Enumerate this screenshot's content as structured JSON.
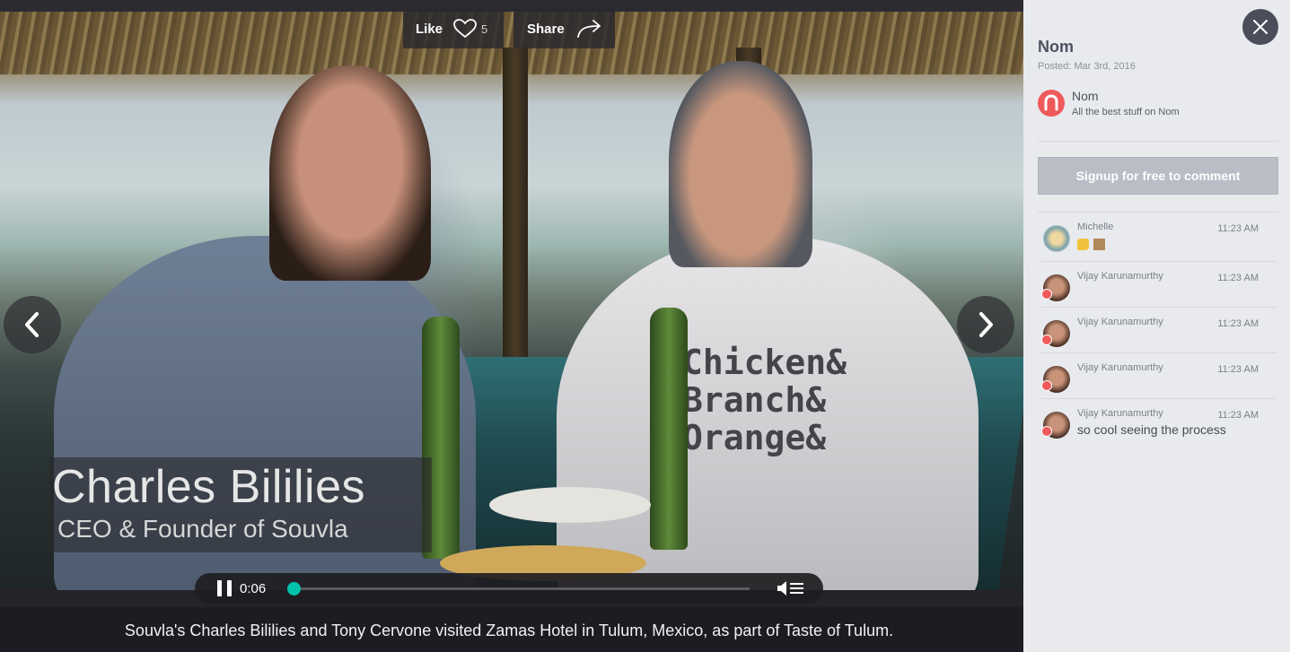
{
  "video": {
    "like_label": "Like",
    "like_count": "5",
    "share_label": "Share",
    "lower_third_name": "Charles Bililies",
    "lower_third_role": "CEO & Founder of Souvla",
    "shirt_text": "Chicken& Branch& Orange&",
    "current_time": "0:06",
    "progress": 0.0,
    "caption": "Souvla's Charles Bililies and Tony Cervone visited Zamas Hotel in Tulum, Mexico, as part of Taste of Tulum."
  },
  "panel": {
    "title": "Nom",
    "posted": "Posted: Mar 3rd, 2016",
    "brand_name": "Nom",
    "brand_tagline": "All the best stuff on Nom",
    "signup_label": "Signup for free to comment",
    "comments": [
      {
        "author": "Michelle",
        "time": "11:23 AM",
        "text": ""
      },
      {
        "author": "Vijay Karunamurthy",
        "time": "11:23 AM",
        "text": ""
      },
      {
        "author": "Vijay Karunamurthy",
        "time": "11:23 AM",
        "text": ""
      },
      {
        "author": "Vijay Karunamurthy",
        "time": "11:23 AM",
        "text": ""
      },
      {
        "author": "Vijay Karunamurthy",
        "time": "11:23 AM",
        "text": "so cool seeing the process"
      }
    ]
  },
  "colors": {
    "accent": "#00c2ad",
    "brand": "#ef5a5a",
    "panel_bg": "#e8eaed"
  },
  "icons": [
    "heart-icon",
    "share-arrow-icon",
    "chevron-left-icon",
    "chevron-right-icon",
    "pause-icon",
    "volume-icon",
    "close-icon",
    "thumbs-up-emoji",
    "box-emoji"
  ]
}
